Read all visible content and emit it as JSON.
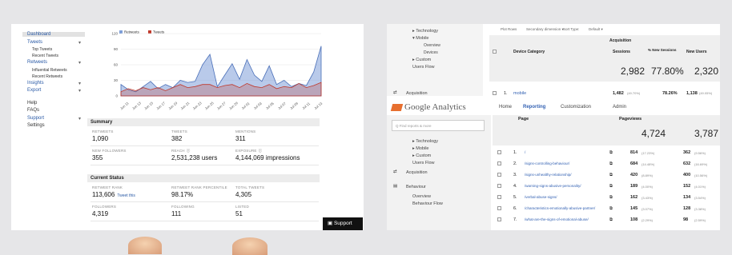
{
  "left": {
    "sidebar": [
      {
        "label": "Dashboard",
        "type": "sel"
      },
      {
        "label": "Tweets",
        "type": "head",
        "chev": true
      },
      {
        "label": "Top Tweets",
        "type": "sub"
      },
      {
        "label": "Recent Tweets",
        "type": "sub"
      },
      {
        "label": "Retweets",
        "type": "head",
        "chev": true
      },
      {
        "label": "Influential Retweets",
        "type": "sub"
      },
      {
        "label": "Recent Retweets",
        "type": "sub"
      },
      {
        "label": "Insights",
        "type": "head",
        "chev": true
      },
      {
        "label": "Export",
        "type": "head",
        "chev": true
      },
      {
        "label": "Help",
        "type": "plain"
      },
      {
        "label": "FAQs",
        "type": "head"
      },
      {
        "label": "Support",
        "type": "head",
        "chev": true
      },
      {
        "label": "Settings",
        "type": "head"
      }
    ],
    "chart_data": {
      "type": "area",
      "series": [
        {
          "name": "Retweets",
          "color": "#7f9fd8",
          "values": [
            22,
            12,
            8,
            18,
            28,
            14,
            22,
            16,
            30,
            26,
            28,
            60,
            80,
            18,
            40,
            62,
            32,
            70,
            40,
            28,
            58,
            22,
            30,
            18,
            24,
            20,
            46,
            96
          ]
        },
        {
          "name": "Tweets",
          "color": "#c0392b",
          "values": [
            8,
            14,
            10,
            16,
            12,
            16,
            10,
            16,
            22,
            16,
            18,
            22,
            22,
            16,
            20,
            22,
            16,
            24,
            18,
            16,
            22,
            14,
            18,
            16,
            24,
            16,
            20,
            26
          ]
        }
      ],
      "x": [
        "Jun 11",
        "Jun 13",
        "Jun 15",
        "Jun 17",
        "Jun 19",
        "Jun 21",
        "Jun 23",
        "Jun 25",
        "Jun 27",
        "Jun 29",
        "Jul 01",
        "Jul 03",
        "Jul 05",
        "Jul 07",
        "Jul 09",
        "Jul 11",
        "Jul 13"
      ],
      "yticks": [
        120,
        90,
        60,
        30,
        0
      ],
      "ylim": [
        0,
        120
      ]
    },
    "summary_title": "Summary",
    "summary": [
      {
        "label": "Retweets",
        "value": "1,090"
      },
      {
        "label": "Tweets",
        "value": "382"
      },
      {
        "label": "Mentions",
        "value": "311"
      },
      {
        "label": "New Followers",
        "value": "355"
      },
      {
        "label": "Reach",
        "value": "2,531,238 users",
        "info": true
      },
      {
        "label": "Exposure",
        "value": "4,144,069 impressions",
        "info": true
      }
    ],
    "status_title": "Current Status",
    "status": [
      {
        "label": "Retweet Rank",
        "value": "113,606",
        "extra": "Tweet this"
      },
      {
        "label": "Retweet Rank Percentile",
        "value": "98.17%"
      },
      {
        "label": "Total Tweets",
        "value": "4,305"
      },
      {
        "label": "Followers",
        "value": "4,319"
      },
      {
        "label": "Following",
        "value": "111"
      },
      {
        "label": "Listed",
        "value": "51"
      }
    ],
    "support": "Support"
  },
  "right": {
    "top_nav": [
      "▸ Technology",
      "▾ Mobile",
      "Overview",
      "Devices",
      "▸ Custom",
      "Users Flow"
    ],
    "toolbar": [
      "Plot Rows",
      "Secondary dimension ▾",
      "Sort Type:",
      "Default ▾"
    ],
    "acq_header": "Acquisition",
    "col_device": "Device Category",
    "col_sessions": "Sessions",
    "col_new": "% New Sessions",
    "col_newusers": "New Users",
    "totals_top": {
      "sessions": "2,982",
      "new": "77.80%",
      "newusers": "2,320"
    },
    "row_mobile": {
      "index": "1.",
      "name": "mobile",
      "sessions": "1,482",
      "sess_pct": "(49.70%)",
      "new": "78.26%",
      "newusers": "1,138",
      "nu_pct": "(49.05%)"
    },
    "acquisition_label": "Acquisition",
    "ga_text": "Google Analytics",
    "tabs": [
      "Home",
      "Reporting",
      "Customization",
      "Admin"
    ],
    "search_placeholder": "Q Find reports & more",
    "nav2": [
      "▸ Technology",
      "▸ Mobile",
      "▸ Custom",
      "Users Flow"
    ],
    "acq2": "Acquisition",
    "behaviour": "Behaviour",
    "beh_items": [
      "Overview",
      "Behaviour Flow"
    ],
    "col_page": "Page",
    "col_pageviews": "Pageviews",
    "totals_bottom": {
      "pageviews": "4,724",
      "unique": "3,787"
    },
    "rows": [
      {
        "n": "1.",
        "page": "/",
        "pv": "814",
        "pvp": "(17.23%)",
        "u": "362",
        "up": "(9.56%)"
      },
      {
        "n": "2.",
        "page": "/signs-controlling-behaviour/",
        "pv": "684",
        "pvp": "(14.48%)",
        "u": "632",
        "up": "(16.69%)"
      },
      {
        "n": "3.",
        "page": "/signs-unhealthy-relationship/",
        "pv": "420",
        "pvp": "(8.89%)",
        "u": "400",
        "up": "(10.56%)"
      },
      {
        "n": "4.",
        "page": "/warning-signs-abusive-personality/",
        "pv": "189",
        "pvp": "(4.00%)",
        "u": "152",
        "up": "(4.01%)"
      },
      {
        "n": "5.",
        "page": "/verbal-abuse-signs/",
        "pv": "162",
        "pvp": "(3.43%)",
        "u": "134",
        "up": "(3.54%)"
      },
      {
        "n": "6.",
        "page": "/characteristics-emotionally-abusive-partner/",
        "pv": "145",
        "pvp": "(3.07%)",
        "u": "128",
        "up": "(3.38%)"
      },
      {
        "n": "7.",
        "page": "/what-are-the-signs-of-emotional-abuse/",
        "pv": "108",
        "pvp": "(2.29%)",
        "u": "98",
        "up": "(2.59%)"
      }
    ]
  }
}
